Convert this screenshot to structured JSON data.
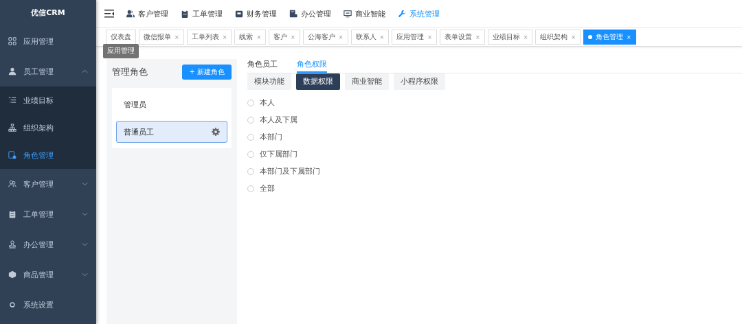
{
  "sidebar": {
    "logo": "优信CRM",
    "items": [
      {
        "label": "应用管理",
        "has_children": false,
        "selected": false
      },
      {
        "label": "员工管理",
        "has_children": true,
        "expanded": true,
        "selected": false,
        "children": [
          {
            "label": "业绩目标",
            "selected": false
          },
          {
            "label": "组织架构",
            "selected": false
          },
          {
            "label": "角色管理",
            "selected": true
          }
        ]
      },
      {
        "label": "客户管理",
        "has_children": true,
        "expanded": false,
        "selected": false
      },
      {
        "label": "工单管理",
        "has_children": true,
        "expanded": false,
        "selected": false
      },
      {
        "label": "办公管理",
        "has_children": true,
        "expanded": false,
        "selected": false
      },
      {
        "label": "商品管理",
        "has_children": true,
        "expanded": false,
        "selected": false
      },
      {
        "label": "系统设置",
        "has_children": false,
        "selected": false
      }
    ]
  },
  "top_nav": [
    {
      "label": "客户管理",
      "selected": false
    },
    {
      "label": "工单管理",
      "selected": false
    },
    {
      "label": "财务管理",
      "selected": false
    },
    {
      "label": "办公管理",
      "selected": false
    },
    {
      "label": "商业智能",
      "selected": false
    },
    {
      "label": "系统管理",
      "selected": true
    }
  ],
  "page_tabs": [
    {
      "label": "仪表盘",
      "closable": false,
      "selected": false
    },
    {
      "label": "微信报单",
      "closable": true,
      "selected": false
    },
    {
      "label": "工单列表",
      "closable": true,
      "selected": false
    },
    {
      "label": "线索",
      "closable": true,
      "selected": false
    },
    {
      "label": "客户",
      "closable": true,
      "selected": false
    },
    {
      "label": "公海客户",
      "closable": true,
      "selected": false
    },
    {
      "label": "联系人",
      "closable": true,
      "selected": false
    },
    {
      "label": "应用管理",
      "closable": true,
      "selected": false
    },
    {
      "label": "表单设置",
      "closable": true,
      "selected": false
    },
    {
      "label": "业绩目标",
      "closable": true,
      "selected": false
    },
    {
      "label": "组织架构",
      "closable": true,
      "selected": false
    },
    {
      "label": "角色管理",
      "closable": true,
      "selected": true
    }
  ],
  "close_glyph": "×",
  "tooltip": "应用管理",
  "roles_panel": {
    "title": "管理角色",
    "new_button": "+ 新建角色",
    "roles": [
      {
        "label": "管理员",
        "selected": false
      },
      {
        "label": "普通员工",
        "selected": true
      }
    ]
  },
  "detail_tabs": [
    {
      "label": "角色员工",
      "selected": false
    },
    {
      "label": "角色权限",
      "selected": true
    }
  ],
  "permission_tabs": [
    {
      "label": "模块功能",
      "selected": false
    },
    {
      "label": "数据权限",
      "selected": true
    },
    {
      "label": "商业智能",
      "selected": false
    },
    {
      "label": "小程序权限",
      "selected": false
    }
  ],
  "data_scope": [
    {
      "label": "本人",
      "selected": false
    },
    {
      "label": "本人及下属",
      "selected": false
    },
    {
      "label": "本部门",
      "selected": false
    },
    {
      "label": "仅下属部门",
      "selected": false
    },
    {
      "label": "本部门及下属部门",
      "selected": false
    },
    {
      "label": "全部",
      "selected": false
    }
  ]
}
